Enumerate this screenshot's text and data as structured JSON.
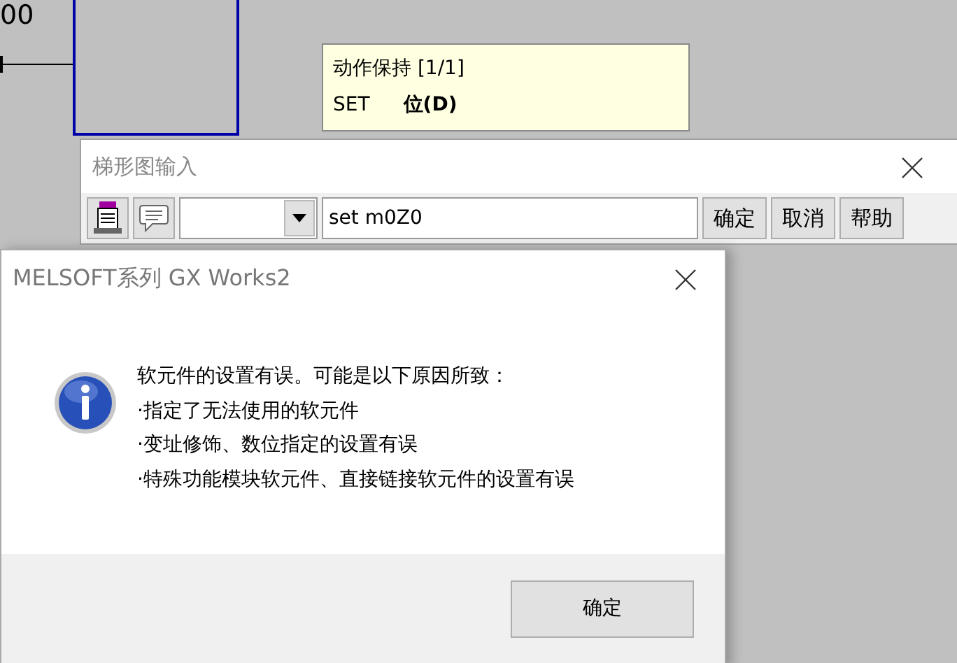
{
  "ladder_canvas": {
    "device_label": "00"
  },
  "tooltip": {
    "title": "动作保持 [1/1]",
    "instruction": "SET",
    "operand": "位(D)"
  },
  "ladder_input": {
    "title": "梯形图输入",
    "input": "set m0Z0",
    "buttons": [
      "确定",
      "取消",
      "帮助"
    ]
  },
  "dialog": {
    "title": "MELSOFT系列 GX Works2",
    "message": [
      "软元件的设置有误。可能是以下原因所致：",
      "·指定了无法使用的软元件",
      "·变址修饰、数位指定的设置有误",
      "·特殊功能模块软元件、直接链接软元件的设置有误"
    ],
    "buttons": [
      "确定"
    ]
  }
}
